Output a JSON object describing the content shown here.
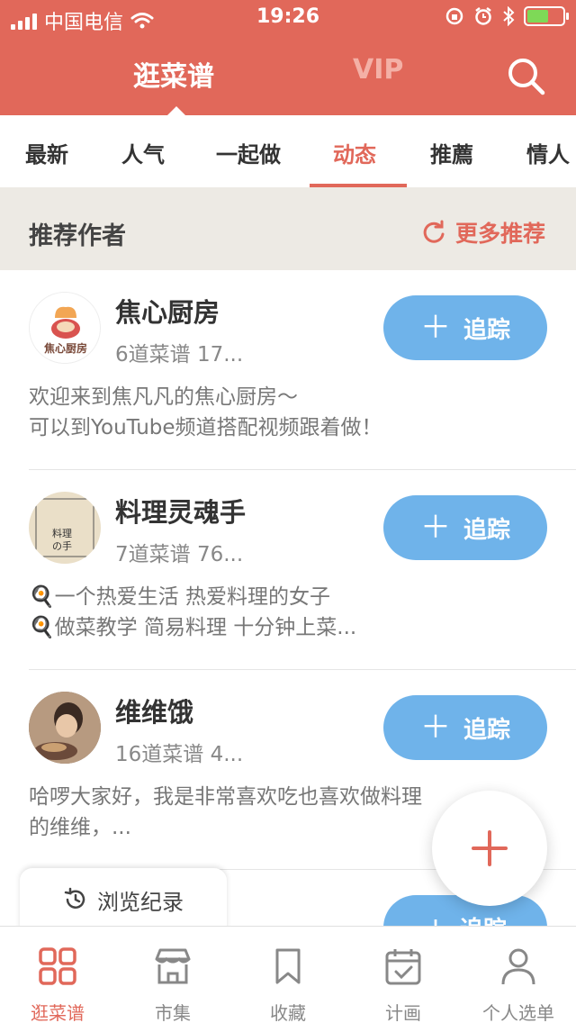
{
  "status_bar": {
    "carrier": "中国电信",
    "time": "19:26"
  },
  "header": {
    "tab_active": "逛菜谱",
    "tab_vip": "VIP",
    "accent_color": "#e1685a"
  },
  "categories": [
    {
      "label": "最新"
    },
    {
      "label": "人气"
    },
    {
      "label": "一起做"
    },
    {
      "label": "动态",
      "active": true
    },
    {
      "label": "推薦"
    },
    {
      "label": "情人"
    }
  ],
  "section": {
    "title": "推荐作者",
    "more_label": "更多推荐"
  },
  "authors": [
    {
      "name": "焦心厨房",
      "stats": "6道菜谱    17...",
      "bio_line1": "欢迎来到焦凡凡的焦心厨房～",
      "bio_line2": "可以到YouTube频道搭配视频跟着做！",
      "avatar_text": "焦心厨房"
    },
    {
      "name": "料理灵魂手",
      "stats": "7道菜谱    76...",
      "bio_line1": "🍳一个热爱生活 热爱料理的女子",
      "bio_line2": "🍳做菜教学   简易料理   十分钟上菜...",
      "avatar_text": "料理の手"
    },
    {
      "name": "维维饿",
      "stats": "16道菜谱    4...",
      "bio_line1": "哈啰大家好，我是非常喜欢吃也喜欢做料理",
      "bio_line2": "的维维，..."
    }
  ],
  "follow_label": "追踪",
  "partial_follow_label": "追踪",
  "history_label": "浏览纪录",
  "bottom_nav": [
    {
      "label": "逛菜谱",
      "icon": "grid-icon",
      "active": true
    },
    {
      "label": "市集",
      "icon": "store-icon"
    },
    {
      "label": "收藏",
      "icon": "bookmark-icon"
    },
    {
      "label": "计画",
      "icon": "calendar-check-icon"
    },
    {
      "label": "个人选单",
      "icon": "person-icon"
    }
  ]
}
